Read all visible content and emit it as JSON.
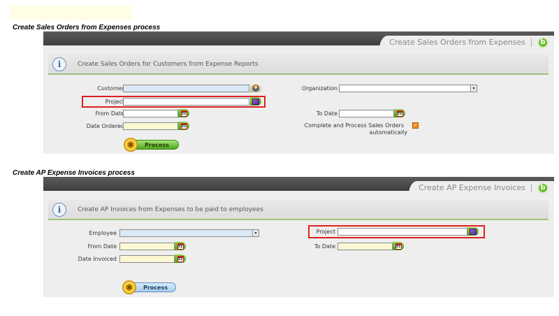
{
  "section1": {
    "title": "Create Sales Orders from Expenses process",
    "tab_label": "Create Sales Orders from Expenses",
    "info_text": "Create Sales Orders for Customers from Expense Reports",
    "fields": {
      "customer_label": "Customer",
      "project_label": "Project",
      "from_date_label": "From Date",
      "date_ordered_label": "Date Ordered",
      "organization_label": "Organization",
      "to_date_label": "To Date",
      "complete_label_line1": "Complete and Process Sales Orders",
      "complete_label_line2": "automatically"
    },
    "process_label": "Process"
  },
  "section2": {
    "title": "Create AP Expense Invoices process",
    "tab_label": "Create AP Expense Invoices",
    "info_text": "Create AP Invoices from Expenses to be paid to employees",
    "fields": {
      "employee_label": "Employee",
      "from_date_label": "From Date",
      "date_invoiced_label": "Date Invoiced",
      "project_label": "Project",
      "to_date_label": "To Date"
    },
    "process_label": "Process"
  },
  "icons": {
    "calendar": "calendar-icon",
    "customer_search": "customer-search-icon",
    "project_search": "project-search-icon",
    "dropdown": "chevron-down-icon",
    "logo": "openbravo-logo-icon",
    "info": "info-icon",
    "gear": "gear-icon"
  },
  "glyphs": {
    "calendar": "31",
    "dropdown": "▾",
    "checkmark": "✓",
    "info": "i",
    "gear": "✱",
    "logo": "b"
  },
  "colors": {
    "topbar": "#4a4a4a",
    "panel": "#eeeeee",
    "highlight": "#e02020",
    "required_field": "#fdf8d4",
    "selected_field": "#dbe9f6"
  }
}
